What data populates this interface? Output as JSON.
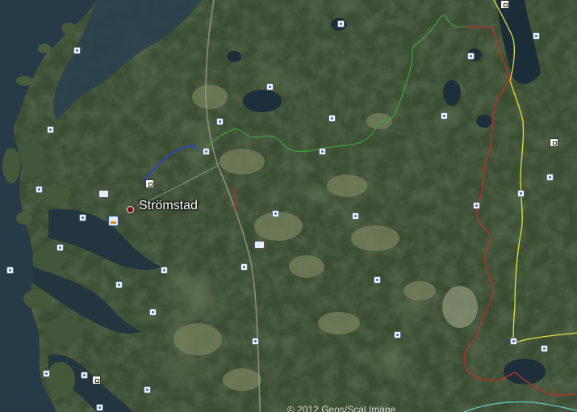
{
  "map": {
    "place_label": "Strömstad",
    "attribution": "© 2012 Geos/Scal Image",
    "colors": {
      "water": "#243845",
      "forest": "#3b4d32",
      "field": "#76805e",
      "route_blue": "#2743d6",
      "route_green": "#3aa03a",
      "border_red": "#b7322a",
      "border_yellow": "#e2e23c",
      "border_cyan": "#5fc9c9"
    },
    "icons": {
      "city_marker": "red-dot-icon",
      "poi": "poi-pin-icon",
      "lodging": "bed-icon",
      "harbor": "harbor-icon",
      "viewpoint": "camera-icon",
      "info": "square-info-icon"
    }
  }
}
